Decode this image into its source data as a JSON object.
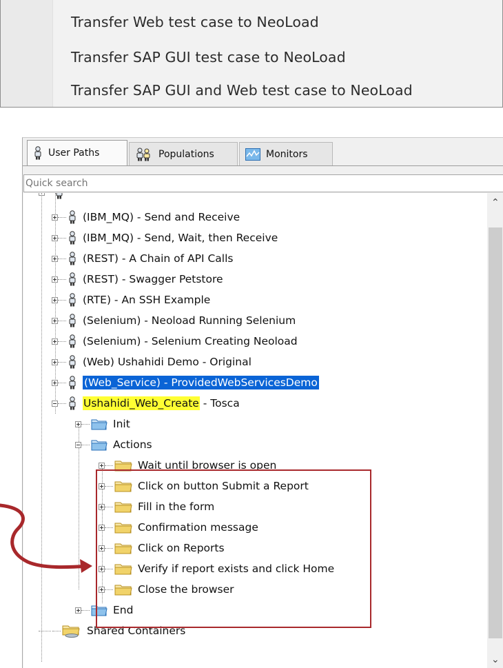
{
  "context_menu": {
    "items": [
      "Transfer Web test case to NeoLoad",
      "Transfer SAP GUI test case to NeoLoad",
      "Transfer SAP GUI and Web test case to NeoLoad"
    ]
  },
  "tabs": [
    {
      "label": "User Paths",
      "active": true
    },
    {
      "label": "Populations",
      "active": false
    },
    {
      "label": "Monitors",
      "active": false
    }
  ],
  "search": {
    "placeholder": "Quick search"
  },
  "tree": {
    "user_paths": [
      "(IBM_MQ) - Send and Receive",
      "(IBM_MQ) - Send, Wait, then Receive",
      "(REST) - A Chain of API Calls",
      "(REST) - Swagger Petstore",
      "(RTE) - An SSH Example",
      "(Selenium) - Neoload Running Selenium",
      "(Selenium) - Selenium Creating Neoload",
      "(Web) Ushahidi Demo - Original",
      "(Web_Service) - ProvidedWebServicesDemo"
    ],
    "expanded_path": {
      "highlight": "Ushahidi_Web_Create",
      "suffix": " - Tosca"
    },
    "containers": {
      "init": "Init",
      "actions": "Actions",
      "end": "End"
    },
    "actions": [
      "Wait until browser is open",
      "Click on button Submit a Report",
      "Fill in the form",
      "Confirmation message",
      "Click on Reports",
      "Verify if report exists and click Home",
      "Close the browser"
    ],
    "shared_containers": "Shared Containers"
  },
  "colors": {
    "selection": "#0a64d6",
    "highlight": "#ffff33",
    "annotation": "#a8282b",
    "folder": "#f1d36a",
    "blue_folder": "#8ec2ec"
  }
}
